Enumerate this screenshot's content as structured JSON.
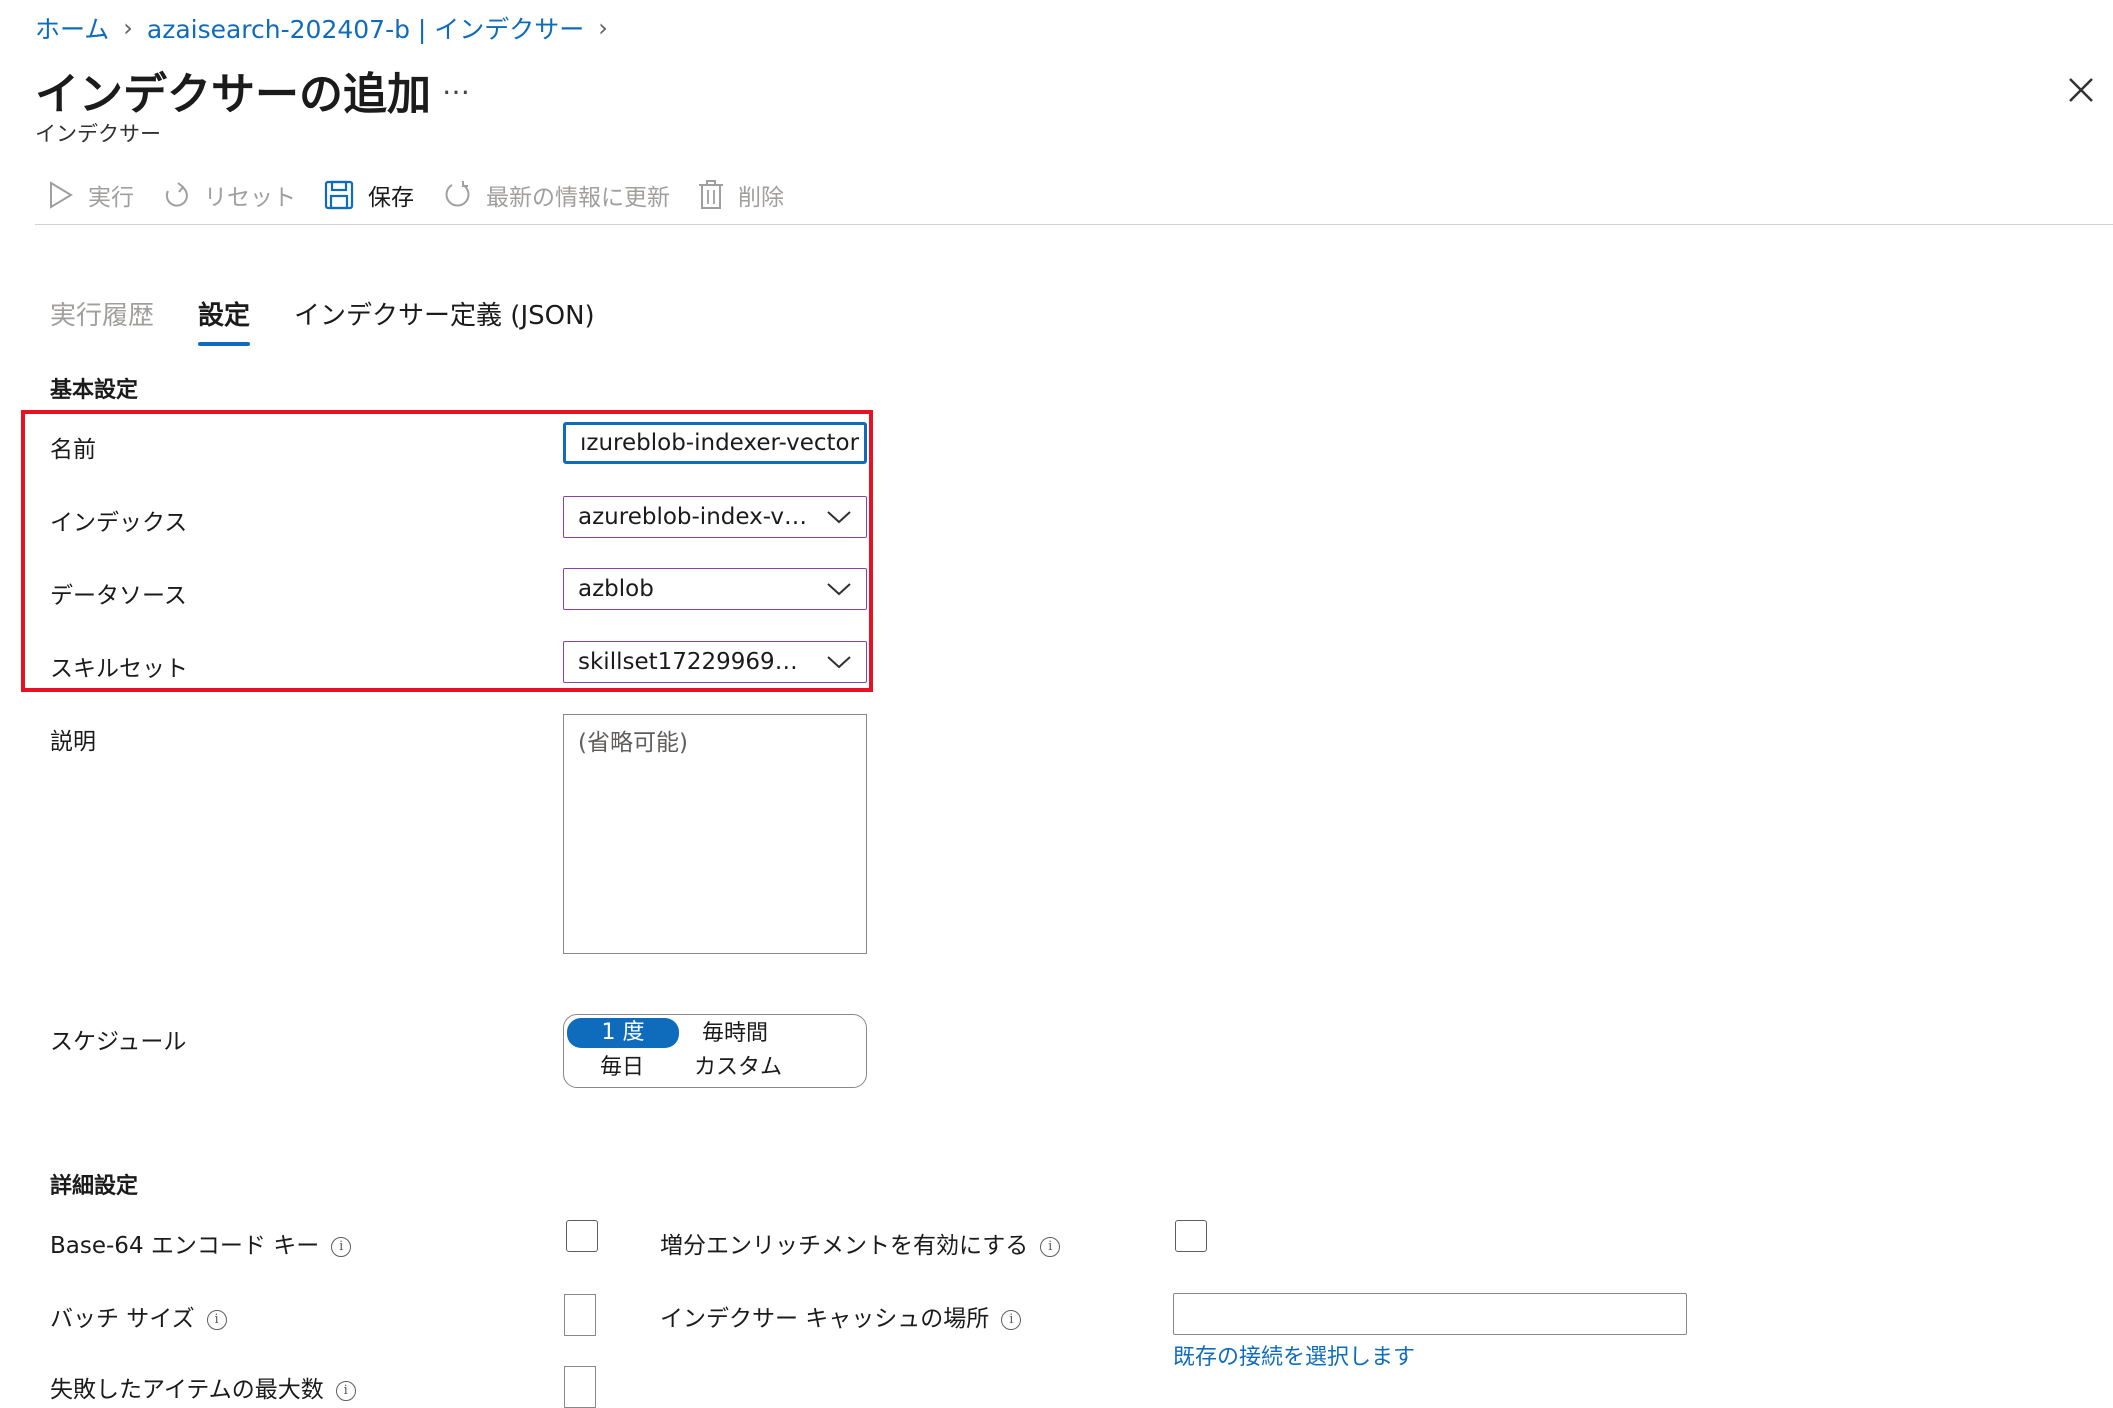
{
  "breadcrumb": {
    "home": "ホーム",
    "service": "azaisearch-202407-b | インデクサー"
  },
  "header": {
    "title": "インデクサーの追加",
    "more": "…",
    "subtitle": "インデクサー"
  },
  "toolbar": {
    "run": "実行",
    "reset": "リセット",
    "save": "保存",
    "refresh": "最新の情報に更新",
    "delete": "削除"
  },
  "tabs": {
    "history": "実行履歴",
    "settings": "設定",
    "json": "インデクサー定義 (JSON)"
  },
  "basic": {
    "section": "基本設定",
    "name_label": "名前",
    "name_value": "ızureblob-indexer-vector",
    "index_label": "インデックス",
    "index_value": "azureblob-index-v…",
    "datasource_label": "データソース",
    "datasource_value": "azblob",
    "skillset_label": "スキルセット",
    "skillset_value": "skillset17229969…",
    "description_label": "説明",
    "description_placeholder": "(省略可能)"
  },
  "schedule": {
    "label": "スケジュール",
    "options": [
      "1 度",
      "毎時間",
      "毎日",
      "カスタム"
    ],
    "selected": "1 度"
  },
  "advanced": {
    "section": "詳細設定",
    "base64_label": "Base-64 エンコード キー",
    "incremental_label": "増分エンリッチメントを有効にする",
    "batch_label": "バッチ サイズ",
    "cache_label": "インデクサー キャッシュの場所",
    "cache_link": "既存の接続を選択します",
    "failed_label": "失敗したアイテムの最大数"
  },
  "info_glyph": "i",
  "colors": {
    "accent": "#0f6cbd",
    "highlight": "#e81123",
    "select_border": "#8b3fa6"
  }
}
